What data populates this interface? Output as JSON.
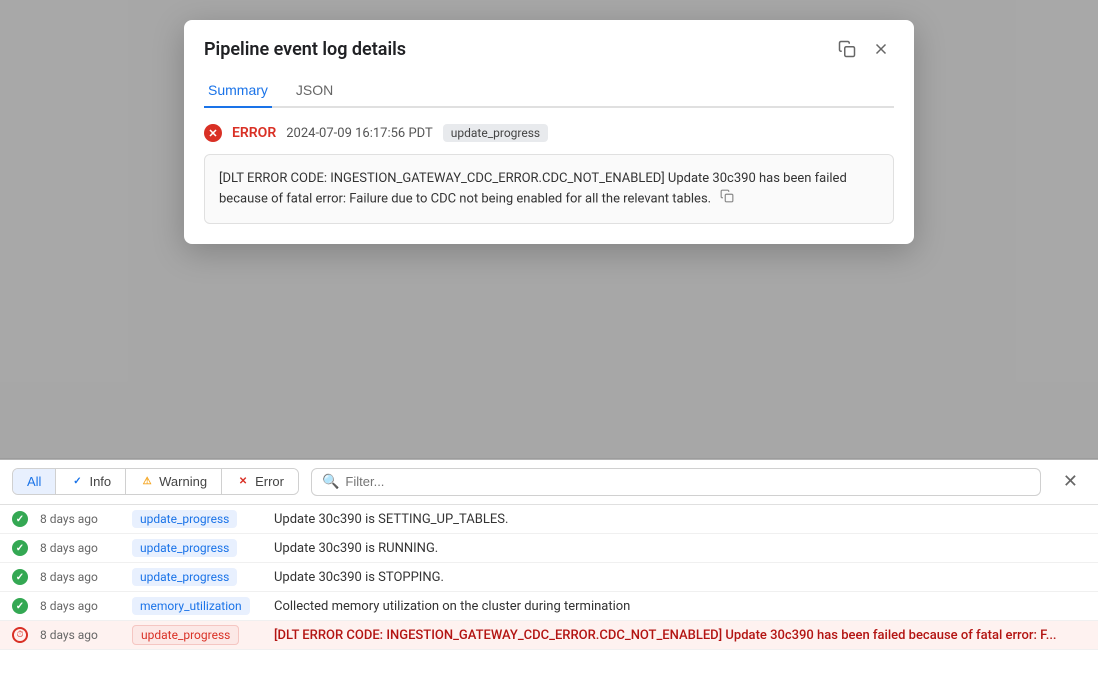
{
  "page": {
    "background_color": "#f0f0f0"
  },
  "modal": {
    "title": "Pipeline event log details",
    "copy_tooltip": "Copy",
    "close_tooltip": "Close",
    "tabs": [
      {
        "id": "summary",
        "label": "Summary",
        "active": true
      },
      {
        "id": "json",
        "label": "JSON",
        "active": false
      }
    ],
    "event": {
      "level": "ERROR",
      "timestamp": "2024-07-09 16:17:56 PDT",
      "type": "update_progress",
      "message": "[DLT ERROR CODE: INGESTION_GATEWAY_CDC_ERROR.CDC_NOT_ENABLED] Update 30c390 has been failed because of fatal error: Failure due to CDC not being enabled for all the relevant tables."
    }
  },
  "filter_bar": {
    "all_label": "All",
    "info_label": "Info",
    "warning_label": "Warning",
    "error_label": "Error",
    "search_placeholder": "Filter..."
  },
  "log_rows": [
    {
      "id": 1,
      "status": "success",
      "time": "8 days ago",
      "type": "update_progress",
      "message": "Update 30c390 is SETTING_UP_TABLES.",
      "is_error": false
    },
    {
      "id": 2,
      "status": "success",
      "time": "8 days ago",
      "type": "update_progress",
      "message": "Update 30c390 is RUNNING.",
      "is_error": false
    },
    {
      "id": 3,
      "status": "success",
      "time": "8 days ago",
      "type": "update_progress",
      "message": "Update 30c390 is STOPPING.",
      "is_error": false
    },
    {
      "id": 4,
      "status": "success",
      "time": "8 days ago",
      "type": "memory_utilization",
      "message": "Collected memory utilization on the cluster during termination",
      "is_error": false
    },
    {
      "id": 5,
      "status": "error",
      "time": "8 days ago",
      "type": "update_progress",
      "message": "[DLT ERROR CODE: INGESTION_GATEWAY_CDC_ERROR.CDC_NOT_ENABLED] Update 30c390 has been failed because of fatal error: F...",
      "is_error": true
    }
  ]
}
